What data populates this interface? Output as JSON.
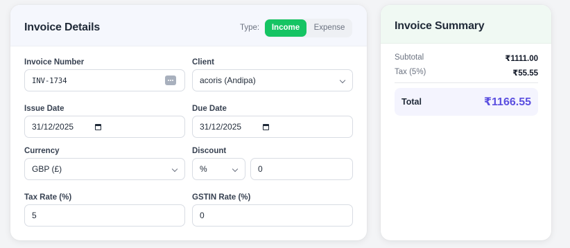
{
  "details": {
    "title": "Invoice Details",
    "type_label": "Type:",
    "type_options": [
      "Income",
      "Expense"
    ],
    "type_selected": "Income",
    "fields": {
      "invoice_number": {
        "label": "Invoice Number",
        "value": "INV-1734"
      },
      "client": {
        "label": "Client",
        "value": "acoris (Andipa)"
      },
      "issue_date": {
        "label": "Issue Date",
        "value": "31/12/2025"
      },
      "due_date": {
        "label": "Due Date",
        "value": "31/12/2025"
      },
      "currency": {
        "label": "Currency",
        "value": "GBP (£)"
      },
      "discount": {
        "label": "Discount",
        "type_value": "%",
        "value": "0"
      },
      "tax_rate": {
        "label": "Tax Rate (%)",
        "value": "5"
      },
      "gstin_rate": {
        "label": "GSTIN Rate (%)",
        "value": "0"
      }
    }
  },
  "summary": {
    "title": "Invoice Summary",
    "rows": [
      {
        "label": "Subtotal",
        "value": "₹1111.00"
      },
      {
        "label": "Tax (5%)",
        "value": "₹55.55"
      }
    ],
    "total_label": "Total",
    "total_value": "₹1166.55"
  },
  "colors": {
    "accent_green": "#15c463",
    "total_purple": "#5b4fe0",
    "header_blue": "#f5f7fd",
    "header_green": "#f0f9f3"
  },
  "icons": [
    "chevron-down-icon",
    "calendar-icon",
    "more-options-icon"
  ]
}
